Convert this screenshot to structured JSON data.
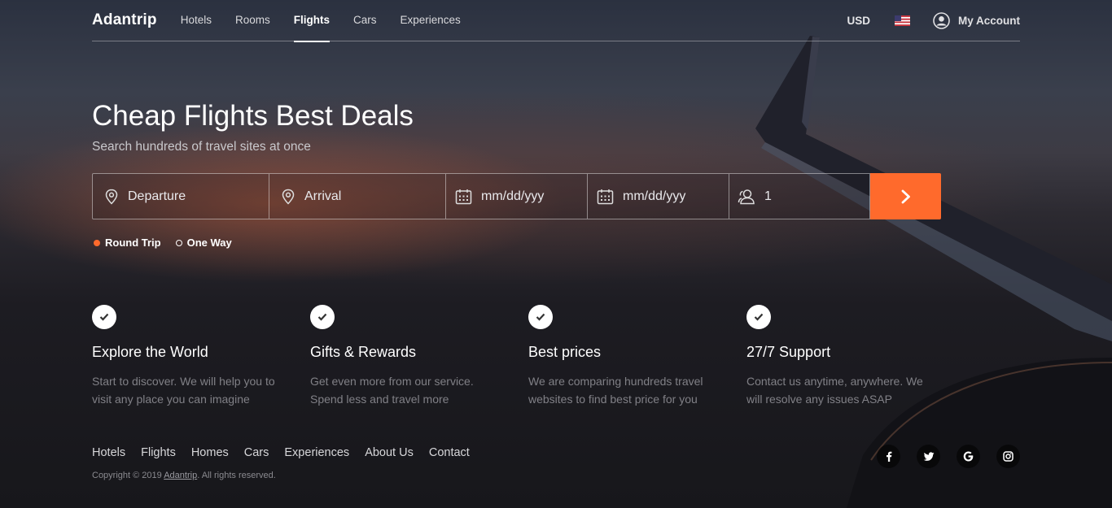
{
  "header": {
    "brand": "Adantrip",
    "nav": [
      "Hotels",
      "Rooms",
      "Flights",
      "Cars",
      "Experiences"
    ],
    "active_nav": "Flights",
    "currency": "USD",
    "account_label": "My Account"
  },
  "hero": {
    "title": "Cheap Flights Best Deals",
    "subtitle": "Search hundreds of travel sites at once"
  },
  "search": {
    "departure_placeholder": "Departure",
    "arrival_placeholder": "Arrival",
    "date1_placeholder": "mm/dd/yyy",
    "date2_placeholder": "mm/dd/yyy",
    "passengers": "1"
  },
  "trip_type": {
    "options": [
      "Round Trip",
      "One Way"
    ],
    "selected": "Round Trip"
  },
  "features": [
    {
      "title": "Explore the World",
      "text": "Start to discover. We will help you to visit any place you can imagine"
    },
    {
      "title": "Gifts & Rewards",
      "text": "Get even more from our service. Spend less and travel more"
    },
    {
      "title": "Best prices",
      "text": "We are comparing hundreds travel websites to find best price for you"
    },
    {
      "title": "27/7 Support",
      "text": "Contact us anytime, anywhere. We will resolve any issues ASAP"
    }
  ],
  "footer": {
    "links": [
      "Hotels",
      "Flights",
      "Homes",
      "Cars",
      "Experiences",
      "About Us",
      "Contact"
    ],
    "copyright_prefix": "Copyright © 2019 ",
    "copyright_link": "Adantrip",
    "copyright_suffix": ". All rights reserved.",
    "social": [
      "facebook-icon",
      "twitter-icon",
      "google-icon",
      "instagram-icon"
    ]
  },
  "colors": {
    "accent": "#ff6a2c"
  }
}
